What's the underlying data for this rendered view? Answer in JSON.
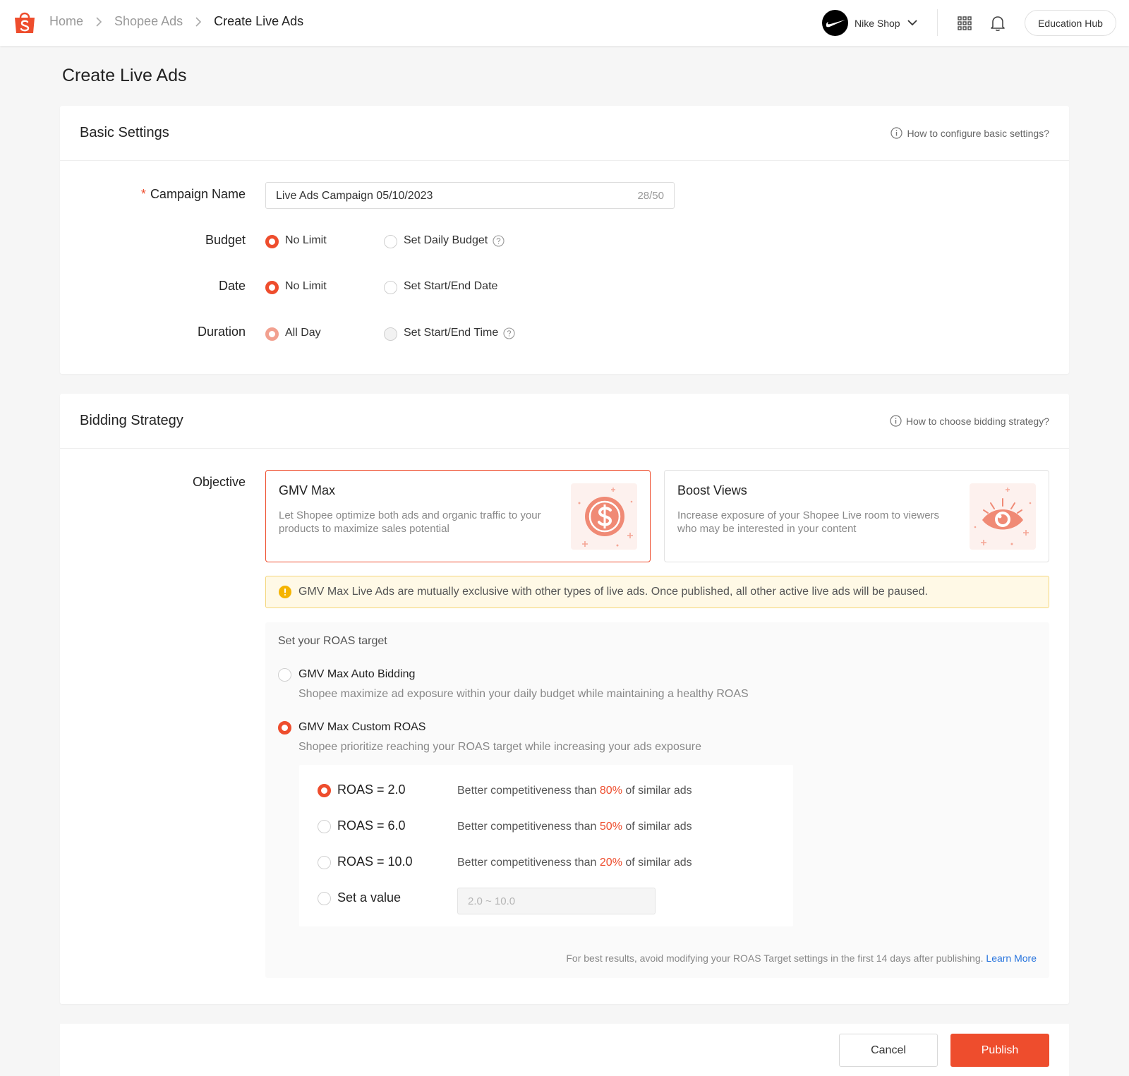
{
  "colors": {
    "brand": "#ee4d2d",
    "link": "#2673dd",
    "warning_bg": "#fff9e6",
    "warning_icon": "#f5b400"
  },
  "breadcrumb": [
    "Home",
    "Shopee Ads",
    "Create Live Ads"
  ],
  "header": {
    "shop_name": "Nike Shop",
    "education_hub": "Education Hub"
  },
  "page_title": "Create Live Ads",
  "basic": {
    "title": "Basic Settings",
    "help": "How to configure basic settings?",
    "campaign_label": "Campaign Name",
    "required_mark": "*",
    "campaign_value": "Live Ads Campaign 05/10/2023",
    "campaign_count": "28/50",
    "budget_label": "Budget",
    "budget_opt1": "No Limit",
    "budget_opt2": "Set Daily Budget",
    "date_label": "Date",
    "date_opt1": "No Limit",
    "date_opt2": "Set Start/End Date",
    "duration_label": "Duration",
    "duration_opt1": "All Day",
    "duration_opt2": "Set Start/End Time"
  },
  "bidding": {
    "title": "Bidding Strategy",
    "help": "How to choose bidding strategy?",
    "objective_label": "Objective",
    "gmv_title": "GMV Max",
    "gmv_desc": "Let Shopee optimize both ads and organic traffic to your products to maximize sales potential",
    "boost_title": "Boost Views",
    "boost_desc": "Increase exposure of your Shopee Live room to viewers who may be interested in your content",
    "notice": "GMV Max Live Ads are mutually exclusive with other types of live ads. Once published, all other active live ads will be paused.",
    "roas_heading": "Set your ROAS target",
    "auto_title": "GMV Max Auto Bidding",
    "auto_desc": "Shopee maximize ad exposure within your daily budget while maintaining a healthy ROAS",
    "custom_title": "GMV Max Custom ROAS",
    "custom_desc": "Shopee prioritize reaching your ROAS target while increasing your ads exposure",
    "comp_prefix": "Better competitiveness than",
    "comp_suffix": "of similar ads",
    "roas_options": [
      {
        "name": "ROAS = 2.0",
        "pct": "80%"
      },
      {
        "name": "ROAS = 6.0",
        "pct": "50%"
      },
      {
        "name": "ROAS = 10.0",
        "pct": "20%"
      }
    ],
    "set_value_label": "Set a value",
    "set_value_placeholder": "2.0 ~ 10.0",
    "footnote": "For best results, avoid modifying your ROAS Target settings in the first 14 days after publishing.",
    "learn_more": "Learn More"
  },
  "footer": {
    "cancel": "Cancel",
    "publish": "Publish"
  }
}
